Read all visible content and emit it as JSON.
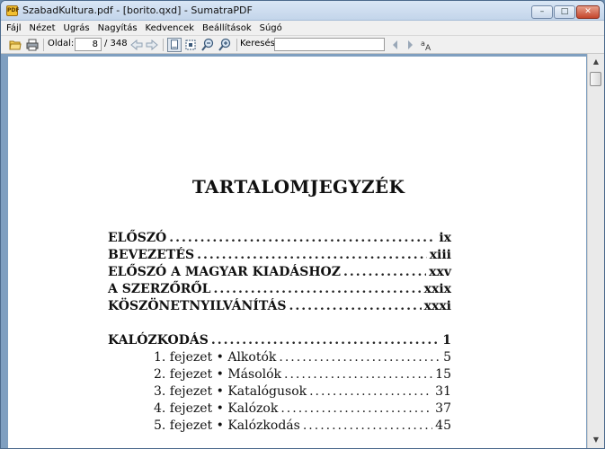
{
  "window": {
    "title": "SzabadKultura.pdf - [borito.qxd] - SumatraPDF",
    "app_icon_label": "PDF",
    "controls": {
      "minimize": "–",
      "maximize": "□",
      "close": "✕"
    }
  },
  "menu": [
    "Fájl",
    "Nézet",
    "Ugrás",
    "Nagyítás",
    "Kedvencek",
    "Beállítások",
    "Súgó"
  ],
  "toolbar": {
    "page_label": "Oldal:",
    "page_value": "8",
    "page_total": "/ 348",
    "search_label": "Keresés:",
    "search_value": "",
    "icons": [
      "open-icon",
      "print-icon",
      "previous-page-icon",
      "next-page-icon",
      "fit-page-icon",
      "fit-width-icon",
      "zoom-out-icon",
      "zoom-in-icon",
      "find-previous-icon",
      "find-next-icon",
      "match-case-icon"
    ]
  },
  "document": {
    "title": "TARTALOMJEGYZÉK",
    "front_matter": [
      {
        "label": "ELŐSZÓ",
        "page": "ix"
      },
      {
        "label": "BEVEZETÉS",
        "page": "xiii"
      },
      {
        "label": "ELŐSZÓ A MAGYAR KIADÁSHOZ",
        "page": "xxv"
      },
      {
        "label": "A SZERZŐRŐL",
        "page": "xxix"
      },
      {
        "label": "KÖSZÖNETNYILVÁNÍTÁS",
        "page": "xxxi"
      }
    ],
    "part": {
      "label": "KALÓZKODÁS",
      "page": "1"
    },
    "chapters": [
      {
        "label": "1. fejezet • Alkotók",
        "page": "5"
      },
      {
        "label": "2. fejezet • Másolók",
        "page": "15"
      },
      {
        "label": "3. fejezet • Katalógusok",
        "page": "31"
      },
      {
        "label": "4. fejezet • Kalózok",
        "page": "37"
      },
      {
        "label": "5. fejezet • Kalózkodás",
        "page": "45"
      }
    ]
  }
}
